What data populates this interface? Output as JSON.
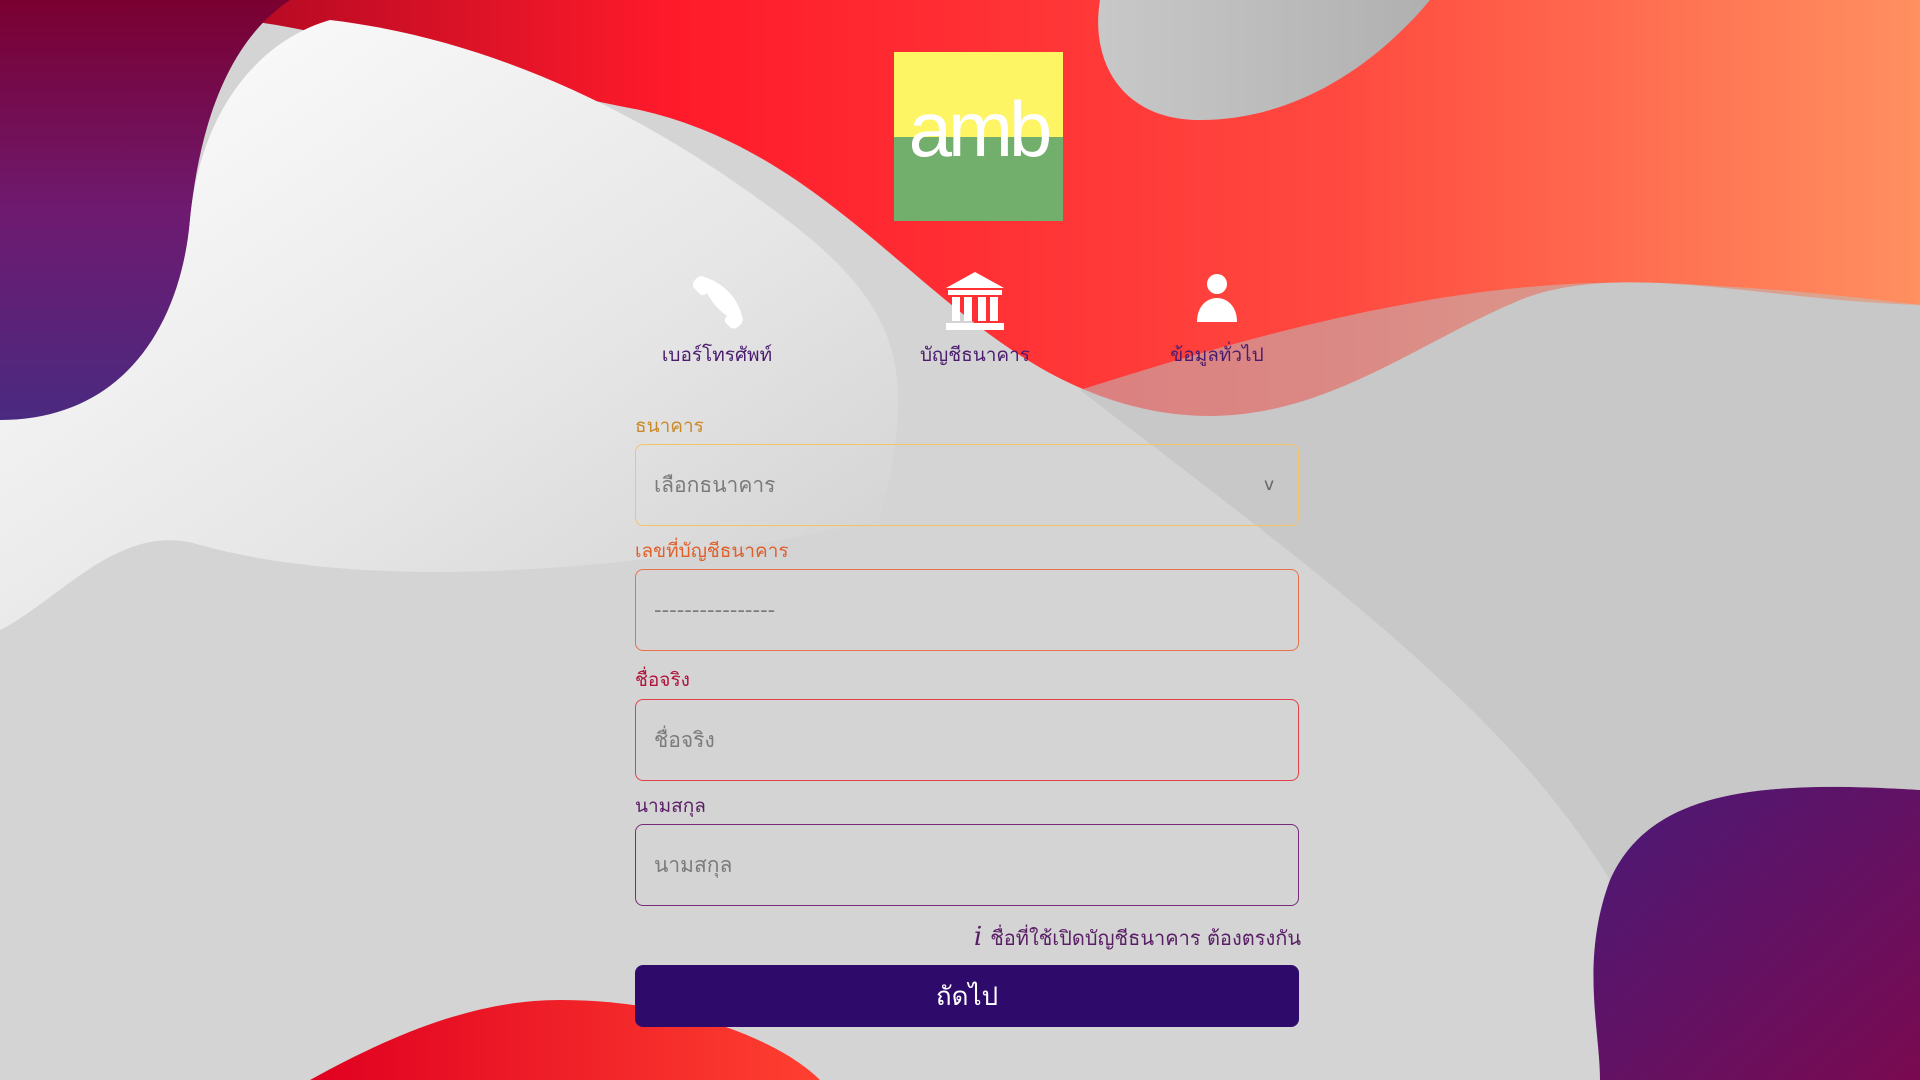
{
  "logo": {
    "text": "amb"
  },
  "steps": [
    {
      "label": "เบอร์โทรศัพท์",
      "icon": "phone-icon"
    },
    {
      "label": "บัญชีธนาคาร",
      "icon": "bank-icon"
    },
    {
      "label": "ข้อมูลทั่วไป",
      "icon": "user-icon"
    }
  ],
  "form": {
    "bank": {
      "label": "ธนาคาร",
      "value": "เลือกธนาคาร",
      "chevron": "v"
    },
    "account": {
      "label": "เลขที่บัญชีธนาคาร",
      "placeholder": "----------------"
    },
    "first_name": {
      "label": "ชื่อจริง",
      "placeholder": "ชื่อจริง"
    },
    "last_name": {
      "label": "นามสกุล",
      "placeholder": "นามสกุล"
    },
    "hint": {
      "icon": "i",
      "text": "ชื่อที่ใช้เปิดบัญชีธนาคาร ต้องตรงกัน"
    },
    "next_label": "ถัดไป"
  },
  "colors": {
    "primary": "#2e0a6b",
    "bank_border": "#f2c46a",
    "account_border": "#e8734a",
    "first_name_border": "#e0404a",
    "last_name_border": "#7a2a7a"
  }
}
